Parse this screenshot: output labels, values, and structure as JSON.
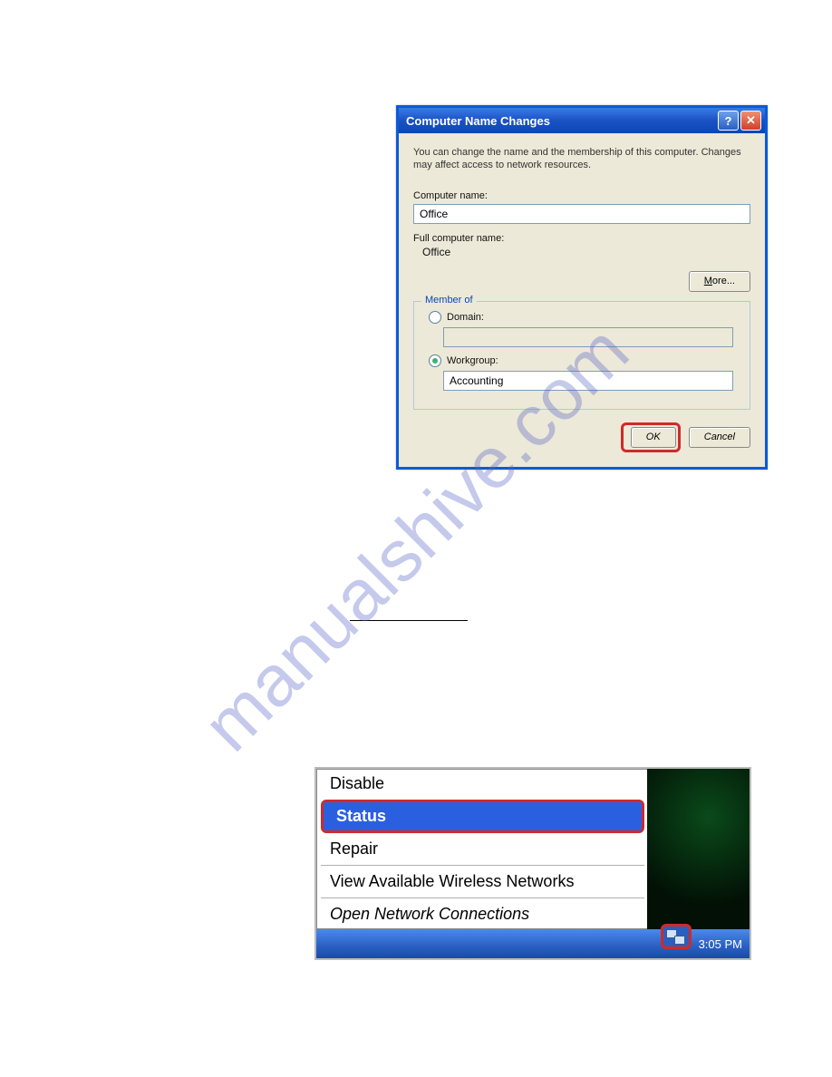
{
  "watermark": "manualshive.com",
  "dialog": {
    "title": "Computer Name Changes",
    "description": "You can change the name and the membership of this computer. Changes may affect access to network resources.",
    "computer_name_label": "Computer name:",
    "computer_name_value": "Office",
    "full_name_label": "Full computer name:",
    "full_name_value": "Office",
    "more_button": "More...",
    "member_of_legend": "Member of",
    "domain_label": "Domain:",
    "domain_value": "",
    "workgroup_label": "Workgroup:",
    "workgroup_value": "Accounting",
    "selected_radio": "workgroup",
    "ok": "OK",
    "cancel": "Cancel"
  },
  "context_menu": {
    "items": {
      "disable": "Disable",
      "status": "Status",
      "repair": "Repair",
      "view_networks": "View Available Wireless Networks",
      "open_connections": "Open Network Connections"
    },
    "clock": "3:05 PM"
  }
}
